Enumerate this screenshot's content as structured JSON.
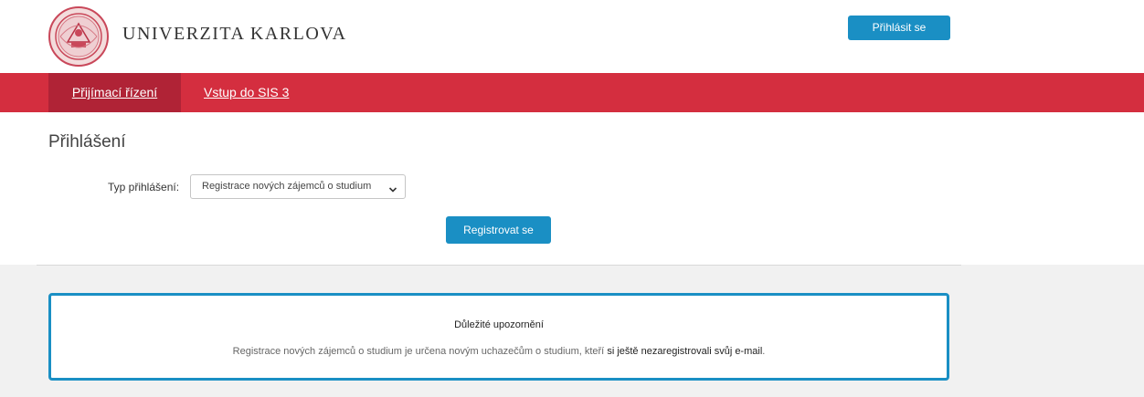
{
  "header": {
    "brand": "UNIVERZITA KARLOVA",
    "login_label": "Přihlásit se",
    "logo_icon": "university-seal-icon"
  },
  "nav": {
    "items": [
      {
        "label": "Přijímací řízení",
        "active": true
      },
      {
        "label": "Vstup do SIS 3",
        "active": false
      }
    ]
  },
  "main": {
    "title": "Přihlášení",
    "login_type_label": "Typ přihlášení:",
    "login_type_selected": "Registrace nových zájemců o studium",
    "register_label": "Registrovat se"
  },
  "notice": {
    "title": "Důležité upozornění",
    "text_prefix": "Registrace nových zájemců o studium je určena novým uchazečům o studium, kteří ",
    "text_emphasis": "si ještě nezaregistrovali svůj e-mail",
    "text_suffix": "."
  },
  "colors": {
    "brand_red": "#d42e3f",
    "active_tab": "#b02336",
    "accent_blue": "#1a8fc4"
  }
}
